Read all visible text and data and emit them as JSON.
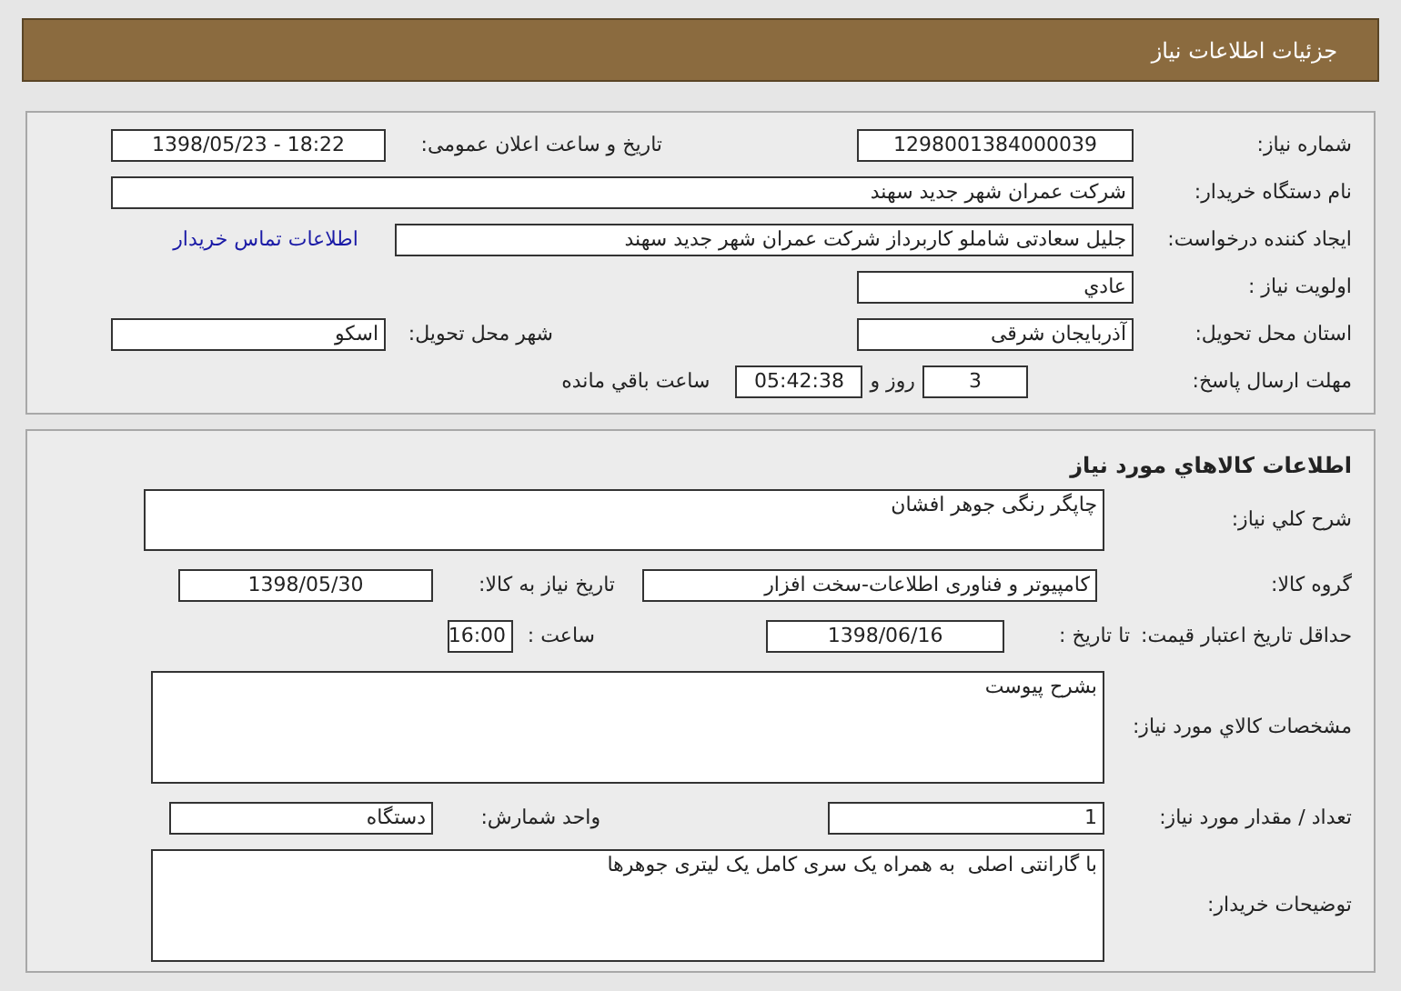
{
  "header": {
    "title": "جزئیات اطلاعات نیاز"
  },
  "need_info": {
    "need_number": {
      "label": "شماره نیاز:",
      "value": "1298001384000039"
    },
    "announce_datetime": {
      "label": "تاریخ و ساعت اعلان عمومی:",
      "value": "1398/05/23 - 18:22"
    },
    "buyer_org": {
      "label": "نام دستگاه خریدار:",
      "value": "شرکت عمران شهر جدید سهند"
    },
    "requester": {
      "label": "ایجاد کننده درخواست:",
      "value": "جلیل سعادتی شاملو کاربرداز شرکت عمران شهر جدید سهند"
    },
    "contact_link": "اطلاعات تماس خریدار",
    "priority": {
      "label": "اولویت نیاز :",
      "value": "عادي"
    },
    "province": {
      "label": "استان محل تحویل:",
      "value": "آذربایجان شرقی"
    },
    "city": {
      "label": "شهر محل تحویل:",
      "value": "اسکو"
    },
    "deadline": {
      "label": "مهلت ارسال پاسخ:",
      "days": "3",
      "days_unit": "روز و",
      "time": "05:42:38",
      "remaining": "ساعت باقي مانده"
    }
  },
  "goods_info": {
    "title": "اطلاعات کالاهاي مورد نیاز",
    "general_description": {
      "label": "شرح کلي نیاز:",
      "value": "چاپگر رنگی جوهر افشان"
    },
    "goods_group": {
      "label": "گروه کالا:",
      "value": "کامپیوتر و فناوری اطلاعات-سخت افزار"
    },
    "need_date": {
      "label": "تاریخ نیاز به کالا:",
      "value": "1398/05/30"
    },
    "price_validity": {
      "label": "حداقل تاریخ اعتبار قیمت:",
      "date_label": "تا تاریخ :",
      "date": "1398/06/16",
      "time_label": "ساعت :",
      "time": "16:00"
    },
    "specifications": {
      "label": "مشخصات کالاي مورد نیاز:",
      "value": "بشرح پیوست"
    },
    "quantity": {
      "label": "تعداد / مقدار مورد نیاز:",
      "value": "1"
    },
    "unit": {
      "label": "واحد شمارش:",
      "value": "دستگاه"
    },
    "buyer_notes": {
      "label": "توضیحات خریدار:",
      "value": "با گارانتی اصلی  به همراه یک سری کامل یک لیتری جوهرها"
    }
  }
}
